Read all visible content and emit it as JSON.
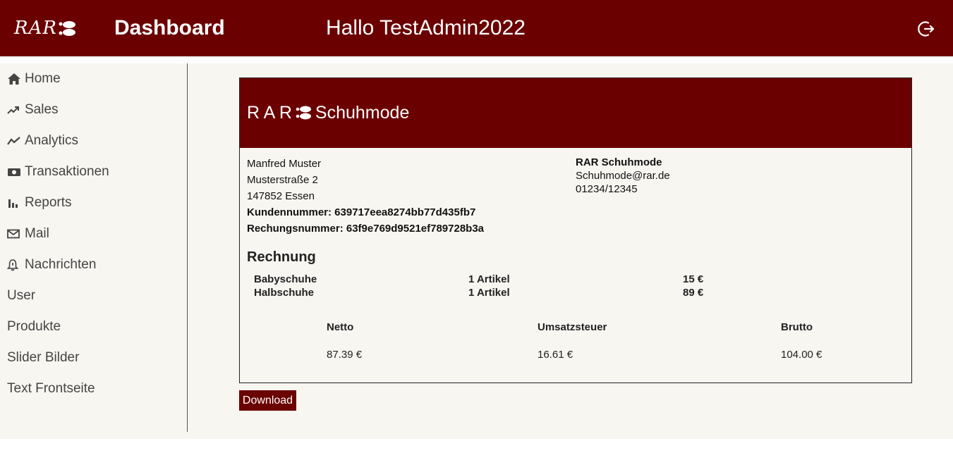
{
  "header": {
    "logo_text": "RAR",
    "title": "Dashboard",
    "greeting": "Hallo TestAdmin2022"
  },
  "sidebar": {
    "items": [
      {
        "label": "Home",
        "icon": "home-icon"
      },
      {
        "label": "Sales",
        "icon": "trending-up-icon"
      },
      {
        "label": "Analytics",
        "icon": "line-chart-icon"
      },
      {
        "label": "Transaktionen",
        "icon": "money-icon"
      },
      {
        "label": "Reports",
        "icon": "bar-chart-icon"
      },
      {
        "label": "Mail",
        "icon": "mail-icon"
      },
      {
        "label": "Nachrichten",
        "icon": "bell-icon"
      },
      {
        "label": "User",
        "icon": ""
      },
      {
        "label": "Produkte",
        "icon": ""
      },
      {
        "label": "Slider Bilder",
        "icon": ""
      },
      {
        "label": "Text Frontseite",
        "icon": ""
      }
    ]
  },
  "invoice": {
    "brand_prefix": "R A R",
    "brand_suffix": "Schuhmode",
    "customer": {
      "name": "Manfred Muster",
      "street": "Musterstraße 2",
      "city": "147852 Essen",
      "customer_number_label": "Kundennummer:",
      "customer_number": "639717eea8274bb77d435fb7",
      "invoice_number_label": "Rechungsnummer:",
      "invoice_number": "63f9e769d9521ef789728b3a"
    },
    "company": {
      "name": "RAR Schuhmode",
      "email": "Schuhmode@rar.de",
      "phone": "01234/12345"
    },
    "section_title": "Rechnung",
    "items": [
      {
        "name": "Babyschuhe",
        "qty": "1 Artikel",
        "price": "15 €"
      },
      {
        "name": "Halbschuhe",
        "qty": "1 Artikel",
        "price": "89 €"
      }
    ],
    "totals": {
      "netto_label": "Netto",
      "netto": "87.39 €",
      "ust_label": "Umsatzsteuer",
      "ust": "16.61 €",
      "brutto_label": "Brutto",
      "brutto": "104.00 €"
    }
  },
  "download_label": "Download",
  "colors": {
    "brand": "#6b0000",
    "background": "#f8f6f1"
  }
}
